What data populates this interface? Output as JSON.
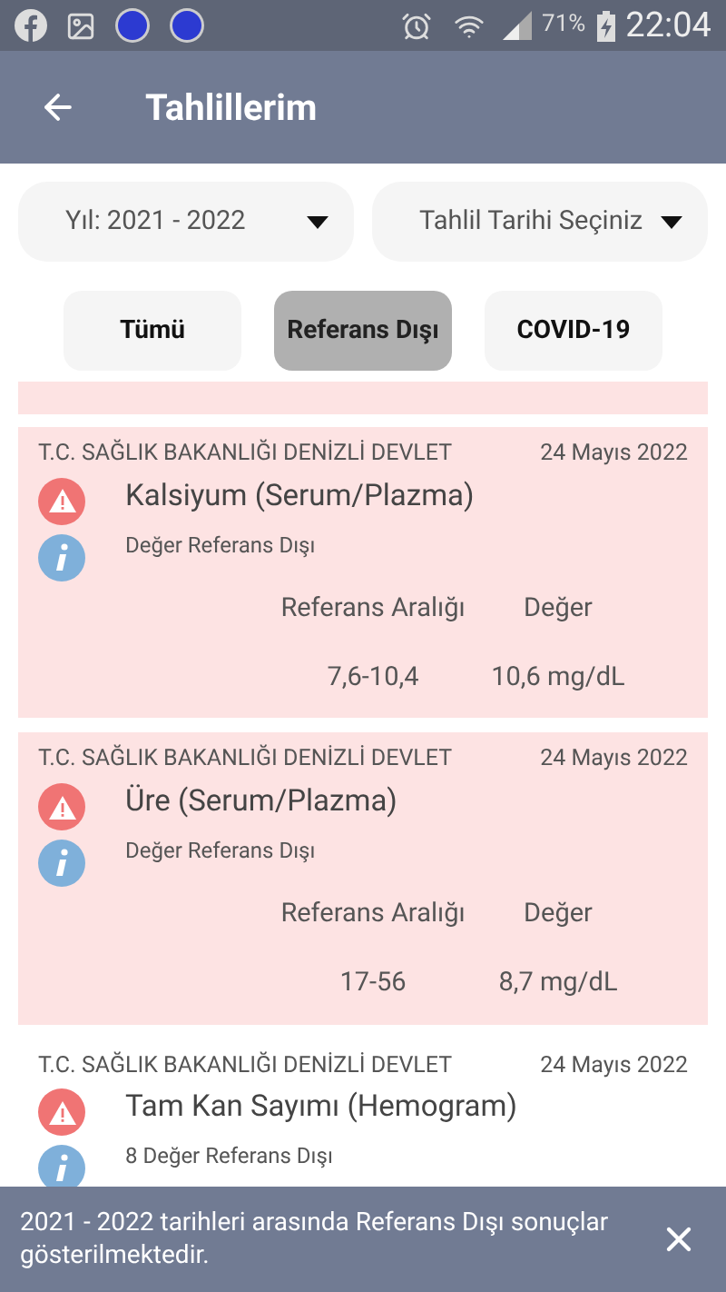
{
  "status_bar": {
    "battery": "71%",
    "time": "22:04"
  },
  "header": {
    "title": "Tahlillerim"
  },
  "filters": [
    {
      "value": "Yıl: 2021 - 2022"
    },
    {
      "value": "Tahlil Tarihi Seçiniz"
    }
  ],
  "tabs": [
    {
      "label": "Tümü",
      "selected": false
    },
    {
      "label": "Referans Dışı",
      "selected": true
    },
    {
      "label": "COVID-19",
      "selected": false
    }
  ],
  "partial_card": {
    "highlighted": true
  },
  "results": [
    {
      "highlighted": true,
      "institution": "T.C. SAĞLIK BAKANLIĞI DENİZLİ DEVLET",
      "date": "24 Mayıs 2022",
      "test": "Kalsiyum (Serum/Plazma)",
      "note": "Değer Referans Dışı",
      "range_label": "Referans Aralığı",
      "value_label": "Değer",
      "range": "7,6-10,4",
      "value": "10,6 mg/dL"
    },
    {
      "highlighted": true,
      "institution": "T.C. SAĞLIK BAKANLIĞI DENİZLİ DEVLET",
      "date": "24 Mayıs 2022",
      "test": "Üre (Serum/Plazma)",
      "note": "Değer Referans Dışı",
      "range_label": "Referans Aralığı",
      "value_label": "Değer",
      "range": "17-56",
      "value": "8,7 mg/dL"
    },
    {
      "highlighted": false,
      "institution": "T.C. SAĞLIK BAKANLIĞI DENİZLİ DEVLET",
      "date": "24 Mayıs 2022",
      "test": "Tam Kan Sayımı (Hemogram)",
      "note": "8 Değer Referans Dışı"
    }
  ],
  "snackbar": {
    "message": "2021 - 2022 tarihleri arasında Referans Dışı sonuçlar gösterilmektedir."
  }
}
